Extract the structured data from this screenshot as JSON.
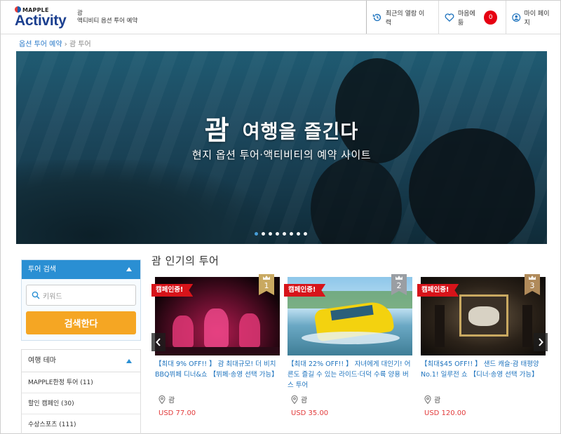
{
  "header": {
    "logo_brand": "MAPPLE",
    "logo_name": "Activity",
    "region": "괌",
    "site_desc": "액티비티 옵션 투어 예약",
    "nav": {
      "history_label": "최근의 열람 이력",
      "favorites_label": "마음에 듦",
      "favorites_count": "0",
      "mypage_label": "마이 페이지"
    }
  },
  "breadcrumb": {
    "home": "옵션 투어 예약",
    "separator": "›",
    "current": "괌 투어"
  },
  "hero": {
    "title_big": "괌",
    "title_rest": "여행을 즐긴다",
    "subtitle": "현지 옵션 투어·액티비티의 예약 사이트",
    "slide_count": 8,
    "active_slide": 0
  },
  "sidebar": {
    "search": {
      "heading": "투어 검색",
      "keyword_placeholder": "키워드",
      "button_label": "검색한다"
    },
    "theme": {
      "heading": "여행 테마",
      "items": [
        {
          "label": "MAPPLE한정 투어 (11)"
        },
        {
          "label": "할인 캠페인 (30)"
        },
        {
          "label": "수상스포츠 (111)"
        }
      ]
    }
  },
  "main": {
    "section_title": "괌 인기의 투어",
    "cards": [
      {
        "tag": "캠페인중!",
        "rank": "1",
        "rank_color": "#c9a961",
        "title": "【최대 9% OFF!! 】 괌 최대규모! 더 비치 BBQ뷔페 디너&쇼 【뷔페·송영 선택 가능】",
        "location": "괌",
        "price": "USD 77.00"
      },
      {
        "tag": "캠페인중!",
        "rank": "2",
        "rank_color": "#9a9ea3",
        "title": "【최대 22% OFF!! 】 자녀에게 대인기! 어른도 즐길 수 있는 라이드·더덕 수륙 양용 버스 투어",
        "location": "괌",
        "price": "USD 35.00"
      },
      {
        "tag": "캠페인중!",
        "rank": "3",
        "rank_color": "#b08a5a",
        "title": "【최대$45 OFF!! 】 샌드 캐슬·괌 태평양No.1! 일루전 쇼 【디너·송영 선택 가능】",
        "location": "괌",
        "price": "USD 120.00"
      }
    ]
  },
  "colors": {
    "accent_blue": "#2a8fd3",
    "link_blue": "#1e73be",
    "search_button": "#f5a623",
    "campaign_red": "#d7141a",
    "price_red": "#e23b3b"
  },
  "icons": [
    "history-icon",
    "heart-icon",
    "user-icon",
    "search-icon",
    "location-pin-icon",
    "crown-icon",
    "chevron-left-icon",
    "chevron-right-icon"
  ]
}
